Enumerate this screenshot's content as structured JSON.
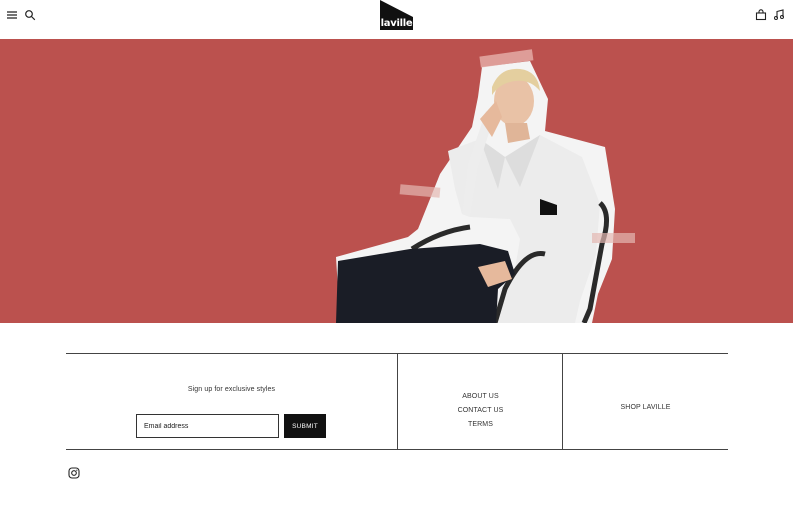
{
  "header": {
    "logo_text": "laville",
    "icons": [
      "menu-icon",
      "search-icon",
      "bag-icon",
      "music-icon"
    ]
  },
  "colors": {
    "hero_background": "#bb514e",
    "dark": "#111111"
  },
  "footer": {
    "signup_text": "Sign up for exclusive styles",
    "email_placeholder": "Email address",
    "submit_label": "SUBMIT",
    "links": [
      "ABOUT US",
      "CONTACT US",
      "TERMS"
    ],
    "shop_label": "SHOP LAVILLE",
    "social_icon": "instagram-icon"
  }
}
